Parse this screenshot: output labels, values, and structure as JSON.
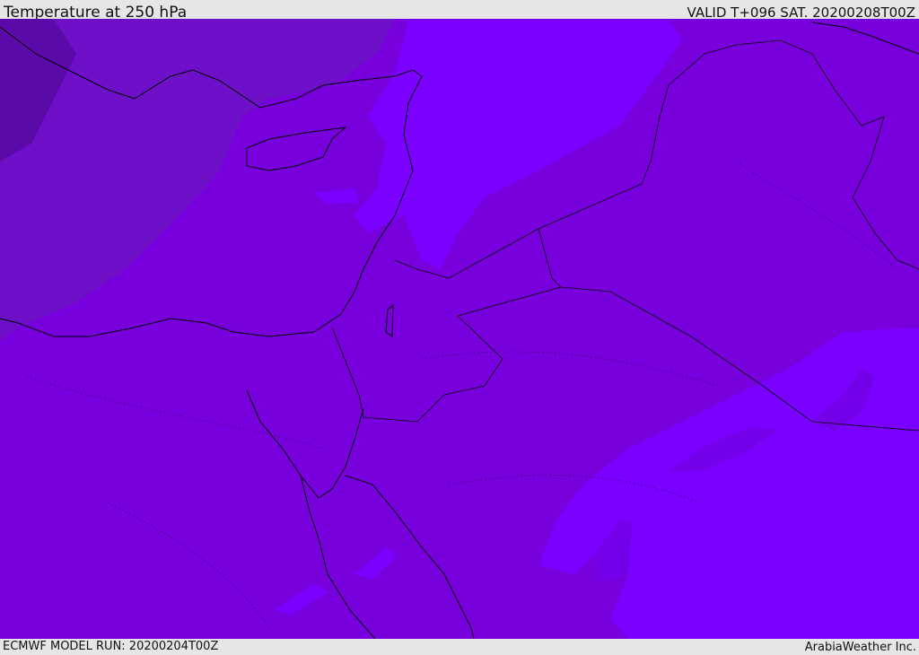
{
  "header": {
    "title": "Temperature at 250 hPa",
    "valid": "VALID T+096 SAT. 20200208T00Z"
  },
  "footer": {
    "model_run": "ECMWF MODEL RUN: 20200204T00Z",
    "credit": "ArabiaWeather Inc."
  },
  "map": {
    "colors": {
      "background": "#7700dd",
      "warm_band": "#7a00ff",
      "cool_west": "#6d10c8",
      "cold_core": "#5a0aa8",
      "coastline": "#000000"
    },
    "icons": [
      "coastline",
      "border",
      "contour-dotted"
    ]
  }
}
